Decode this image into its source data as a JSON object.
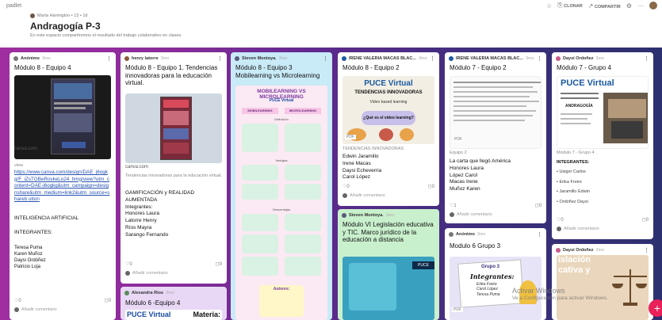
{
  "app": {
    "brand": "padlet"
  },
  "toolbar": {
    "clone_label": "CLONAR",
    "share_label": "COMPARTIR",
    "more": "···"
  },
  "header": {
    "author_meta": "María Harrington • 13 • 1d",
    "title": "Andragogía P-3",
    "description": "En este espacio compartiremos el resultado del trabajo colaborativo en clases."
  },
  "posts": [
    {
      "author": "Anónimo",
      "time": "3mo",
      "title": "Módulo 8 - Equipo 4",
      "site": "canva.com",
      "site_sub": "view",
      "link": "https://www.canva.com/design/DAE_j6ogkg/F_iZsTGBeRovkeLo24_hmg/view?utm_content=DAE-j6ogkg&utm_campaign=designshare&utm_medium=link2&utm_source=shareb utton",
      "body_lines": [
        "INTELIGENCIA ARTIFICIAL",
        "INTEGRANTES:",
        "Teresa Puma",
        "Karen Muñoz",
        "Daysi Ordóñez",
        "Patricio Loja"
      ],
      "likes": "0",
      "comments": "0",
      "add_comment": "Añadir comentario"
    },
    {
      "author": "henry latorre",
      "time": "3mo",
      "title": "Módulo 8 - Equipo 1. Tendencias innovadoras para la educación virtual.",
      "site": "canva.com",
      "site_sub": "Tendencias innovadoras para la educación virtual.",
      "body_lines": [
        "GAMIFICACIÓN y REALIDAD AUMENTADA",
        "Integrantes:",
        "Honores Laura",
        "Latorre Henry",
        "Ríos Mayra",
        "Sarango Fernando"
      ],
      "likes": "0",
      "comments": "0",
      "add_comment": "Añadir comentario"
    },
    {
      "author": "Steven Montoya.",
      "time": "3mo",
      "title": "Módulo 8 - Equipo 3 Mobilearning vs Microlearning",
      "poster_title": "MOBILEARNING VS MICROLEARNING",
      "poster_brand": "PUCE Virtual",
      "col_a": "MOBILEARNING",
      "col_b": "MICROLEARNING",
      "sec1": "Definición",
      "sec2": "Ventajas",
      "sec3": "Desventajas",
      "authors": "Autores:"
    },
    {
      "author": "IRENE VALERIA MACAS BLAC...",
      "time": "3mo",
      "title": "Módulo 8 - Equipo 2",
      "poster_brand": "PUCE Virtual",
      "poster_line1": "TENDENCIAS INNOVADORAS",
      "poster_line2": "Video based learning",
      "poster_q": "¿Qué es el video learning?",
      "file_tag": "PDF",
      "sub": "TENDENCIAS INNOVADORAS",
      "body_lines": [
        "Edwin Jaramillo",
        "Irene Macas",
        "Daysi Echeverria",
        "Carol López"
      ],
      "likes": "0",
      "comments": "0",
      "add_comment": "Añadir comentario"
    },
    {
      "author": "IRENE VALERIA MACAS BLAC...",
      "time": "3mo",
      "title": "Módulo 7 - Equipo 2",
      "file_tag": "PDF",
      "sub": "Equipo 2",
      "body_lines": [
        "La carta que llegó América",
        "Honores Laura",
        "López Carol",
        "Macas Irene",
        "Muñoz Karen"
      ],
      "likes": "1",
      "comments": "0",
      "add_comment": "Añadir comentario"
    },
    {
      "author": "Daysi Ordoñez",
      "time": "3mo",
      "title": "Módulo 7 - Grupo 4",
      "poster_brand": "PUCE Virtual",
      "poster_line": "ANDRAGOGÍA",
      "sub": "Módulo 7 - Grupo 4",
      "body_lines": [
        "INTEGRANTES:",
        "• Usiger Carlos",
        "• Erika Freire",
        "• Jaramillo Edwin",
        "• Ordoñez Daysi"
      ],
      "likes": "0",
      "comments": "0",
      "add_comment": "Añadir comentario"
    },
    {
      "author": "Alexandra Rios",
      "time": "3mo",
      "title": "Módulo 6 -Equipo 4",
      "poster_brand": "PUCE Virtual",
      "poster_right": "Materia:"
    },
    {
      "author": "Steven Montoya.",
      "time": "3mo",
      "title": "Módulo VI Legislación educativa y TIC. Marco jurídico de la educación a distancia",
      "poster_brand": "PUCE"
    },
    {
      "author": "Anónimo",
      "time": "3mo",
      "title": "Modulo 6 Grupo 3",
      "poster_line1": "Grupo 3",
      "poster_line2": "Integrantes:",
      "poster_names": [
        "Erika Freire",
        "Carol López",
        "Teresa Puma"
      ],
      "file_tag": "PDF"
    },
    {
      "author": "Daysi Ordoñez",
      "time": "3mo",
      "poster_line1": "islación",
      "poster_line2": "cativa y"
    }
  ],
  "os_watermark": {
    "line1": "Activar Windows",
    "line2": "Ve a Configuración para activar Windows."
  },
  "fab": {
    "label": "+"
  },
  "colors": {
    "board_gradient": [
      "#a02ea0",
      "#2d3070"
    ],
    "fab": "#e9205a",
    "blue_card": "#c9eaf7",
    "green_card": "#c9f0cc",
    "lav_card": "#e8d8f5"
  }
}
